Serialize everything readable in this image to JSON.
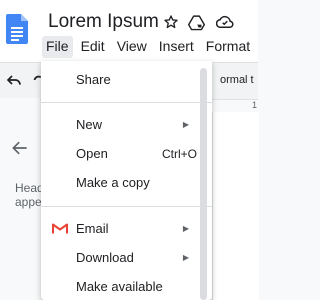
{
  "doc": {
    "title": "Lorem Ipsum"
  },
  "menubar": {
    "items": [
      "File",
      "Edit",
      "View",
      "Insert",
      "Format"
    ]
  },
  "toolbar": {
    "style_label": "ormal t"
  },
  "ruler": {
    "marker": "1"
  },
  "side_panel": {
    "line1": "Head",
    "line2": "appe"
  },
  "file_menu": {
    "share": "Share",
    "new": "New",
    "open": "Open",
    "open_shortcut": "Ctrl+O",
    "make_copy": "Make a copy",
    "email": "Email",
    "download": "Download",
    "make_available": "Make available"
  },
  "icons": {
    "app": "google-docs-icon",
    "star": "star-icon",
    "move": "move-to-drive-icon",
    "cloud": "cloud-status-icon",
    "undo": "undo-icon",
    "back": "arrow-left-icon",
    "email": "gmail-icon",
    "submenu": "triangle-right-icon"
  },
  "colors": {
    "docs_blue": "#4285f4",
    "gmail_red": "#ea4335",
    "menu_active": "#e8eaed"
  }
}
